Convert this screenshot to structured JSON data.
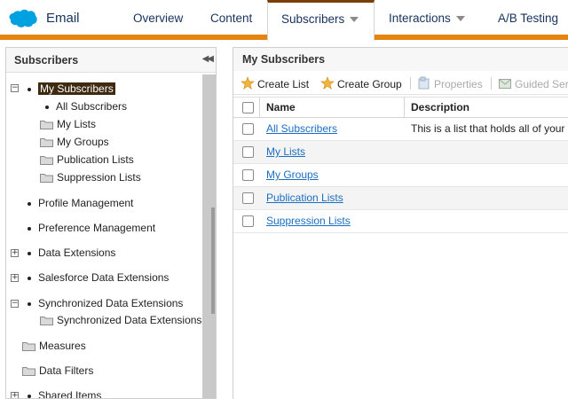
{
  "app": {
    "name": "Email",
    "logo": "salesforce-cloud-logo",
    "brand_color": "#00a1e0",
    "accent_color": "#e4830f"
  },
  "nav": {
    "tabs": [
      {
        "label": "Overview"
      },
      {
        "label": "Content"
      },
      {
        "label": "Subscribers",
        "active": true,
        "has_dropdown": true
      },
      {
        "label": "Interactions",
        "has_dropdown": true
      },
      {
        "label": "A/B Testing"
      }
    ]
  },
  "left_panel": {
    "title": "Subscribers",
    "collapse_icon": "double-chevron-left-icon",
    "tree": [
      {
        "label": "My Subscribers",
        "selected": true,
        "expander": "−"
      },
      {
        "label": "All Subscribers"
      },
      {
        "label": "My Lists",
        "icon": "folder-icon"
      },
      {
        "label": "My Groups",
        "icon": "folder-icon"
      },
      {
        "label": "Publication Lists",
        "icon": "folder-icon"
      },
      {
        "label": "Suppression Lists",
        "icon": "folder-icon"
      },
      {
        "label": "Profile Management"
      },
      {
        "label": "Preference Management"
      },
      {
        "label": "Data Extensions",
        "expander": "+"
      },
      {
        "label": "Salesforce Data Extensions",
        "expander": "+"
      },
      {
        "label": "Synchronized Data Extensions",
        "expander": "−"
      },
      {
        "label": "Synchronized Data Extensions",
        "icon": "folder-icon"
      },
      {
        "label": "Measures",
        "icon": "folder-icon"
      },
      {
        "label": "Data Filters",
        "icon": "folder-icon"
      },
      {
        "label": "Shared Items",
        "expander": "+"
      }
    ]
  },
  "right_panel": {
    "title": "My Subscribers",
    "toolbar": {
      "create_list": "Create List",
      "create_group": "Create Group",
      "properties": "Properties",
      "guided_send": "Guided Ser"
    },
    "columns": {
      "name": "Name",
      "description": "Description"
    },
    "rows": [
      {
        "name": "All Subscribers",
        "description": "This is a list that holds all of your"
      },
      {
        "name": "My Lists",
        "description": ""
      },
      {
        "name": "My Groups",
        "description": ""
      },
      {
        "name": "Publication Lists",
        "description": ""
      },
      {
        "name": "Suppression Lists",
        "description": ""
      }
    ]
  }
}
